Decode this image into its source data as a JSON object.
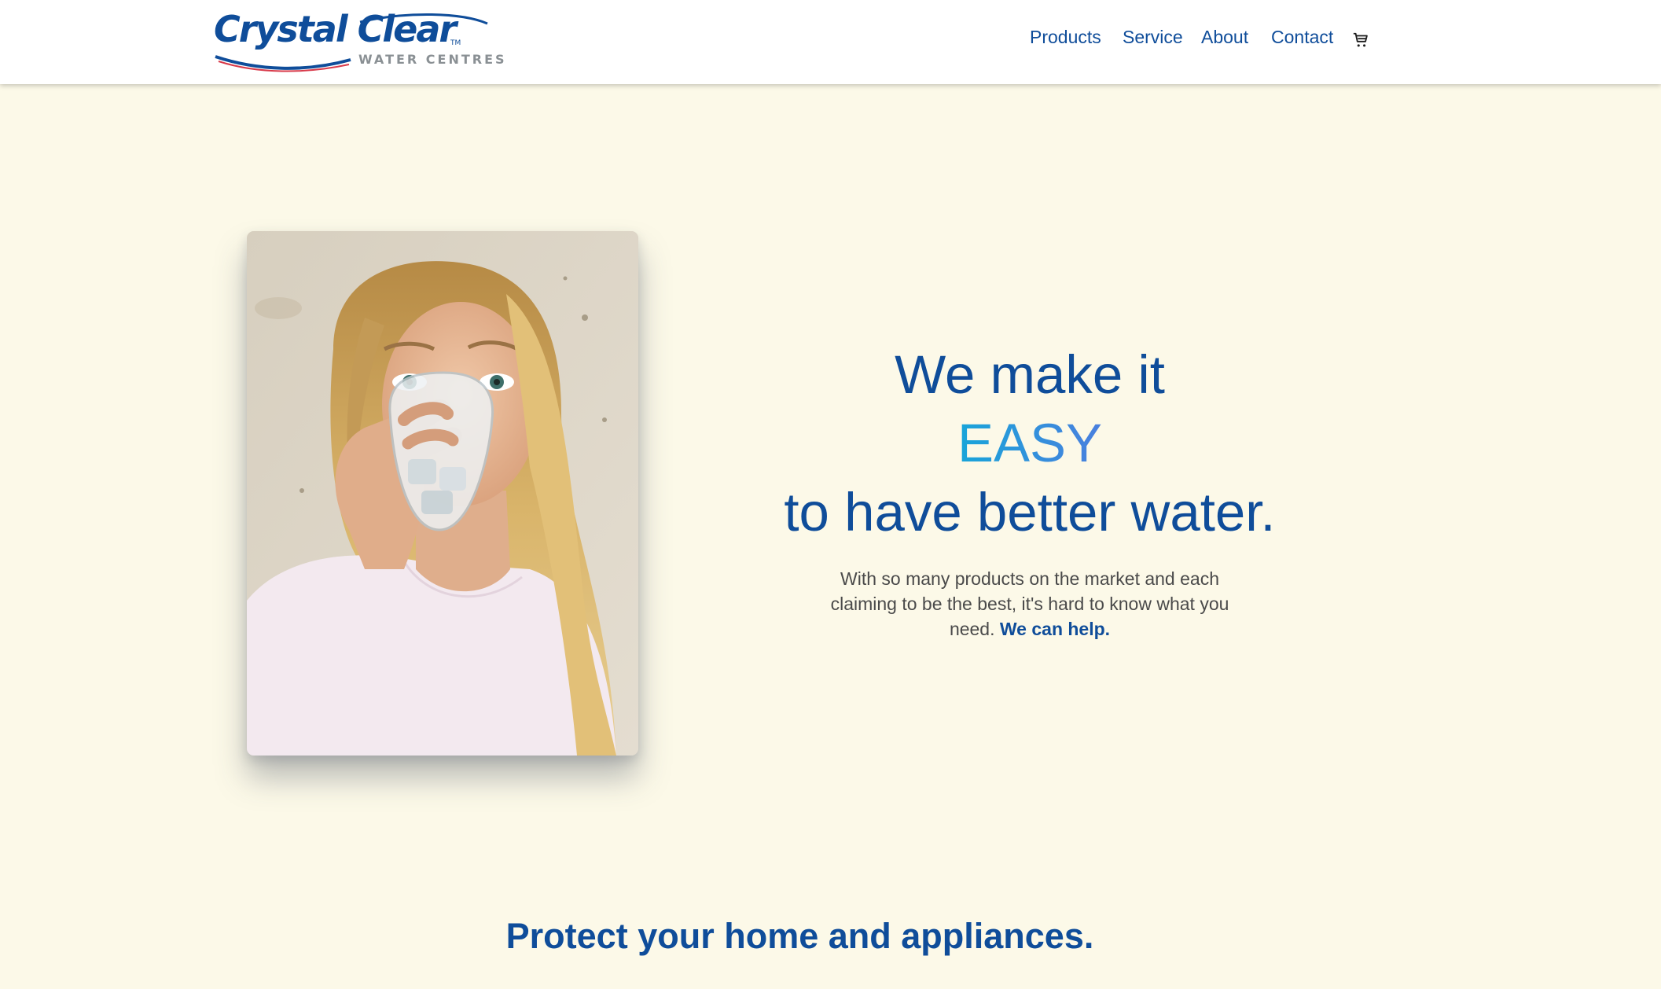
{
  "brand": {
    "name": "Crystal Clear",
    "tm": "TM",
    "tagline": "WATER CENTRES"
  },
  "nav": {
    "items": [
      "Products",
      "Service",
      "About",
      "Contact"
    ],
    "cart_icon": "cart-icon"
  },
  "hero": {
    "line1": "We make it",
    "line2": "EASY",
    "line3": "to have better water.",
    "intro_text": "With so many products on the market and each claiming to be the best, it's hard to know what you need.",
    "intro_emphasis": "We can help."
  },
  "section": {
    "title": "Protect your home and appliances."
  },
  "colors": {
    "brand_blue": "#0f4d9a",
    "background": "#fcf9e8",
    "accent_cyan": "#18a5d9",
    "accent_blue": "#4a7fde"
  }
}
